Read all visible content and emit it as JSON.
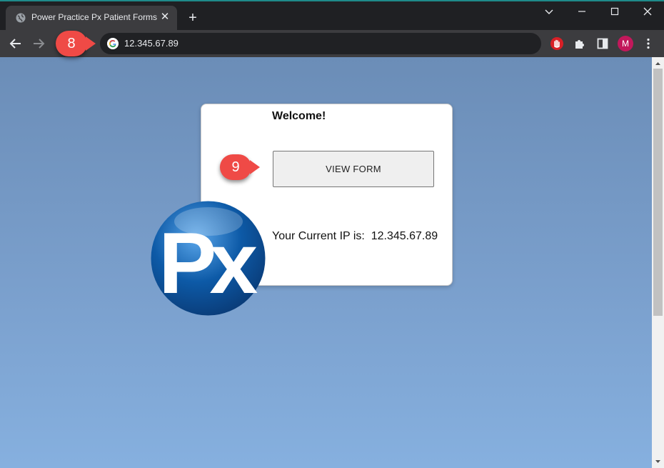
{
  "browser": {
    "tab_title": "Power Practice Px Patient Forms",
    "tab_close": "✕",
    "new_tab": "+",
    "url": "12.345.67.89",
    "profile_initial": "M",
    "window_controls": {
      "dropdown": "⌄",
      "minimize": "—",
      "maximize": "☐",
      "close": "✕"
    }
  },
  "annotations": {
    "badge_8": "8",
    "badge_9": "9"
  },
  "card": {
    "welcome": "Welcome!",
    "button_label": "VIEW FORM",
    "ip_label": "Your Current IP is:",
    "ip_value": "12.345.67.89"
  },
  "logo": {
    "text": "Px"
  },
  "colors": {
    "accent": "#ef4a46",
    "page_top": "#6b8db7",
    "page_bottom": "#86b0df",
    "logo_blue": "#0d5aa7",
    "profile": "#c2185b"
  }
}
